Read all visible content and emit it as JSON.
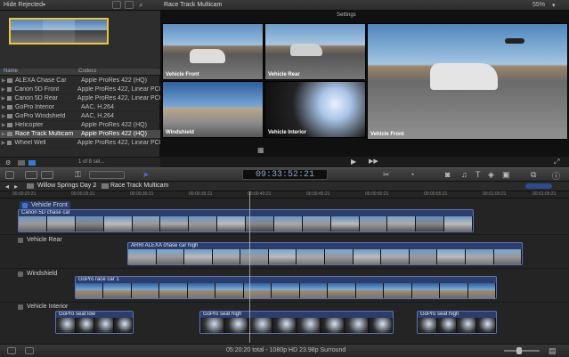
{
  "browser": {
    "filter_label": "Hide Rejected",
    "columns": {
      "name": "Name",
      "codecs": "Codecs"
    },
    "items": [
      {
        "name": "ALEXA Chase Car",
        "codec": "Apple ProRes 422 (HQ)"
      },
      {
        "name": "Canon 5D Front",
        "codec": "Apple ProRes 422, Linear PCM"
      },
      {
        "name": "Canon 5D Rear",
        "codec": "Apple ProRes 422, Linear PCM"
      },
      {
        "name": "GoPro Interior",
        "codec": "AAC, H.264"
      },
      {
        "name": "GoPro Windshield",
        "codec": "AAC, H.264"
      },
      {
        "name": "Helicopter",
        "codec": "Apple ProRes 422 (HQ)"
      },
      {
        "name": "Race Track Multicam",
        "codec": "Apple ProRes 422 (HQ)"
      },
      {
        "name": "Wheel Well",
        "codec": "Apple ProRes 422, Linear PCM"
      }
    ],
    "selection_status": "1 of 8 sel..."
  },
  "viewer": {
    "title": "Race Track Multicam",
    "zoom": "55%",
    "settings_label": "Settings",
    "angles": [
      {
        "label": "Vehicle Front"
      },
      {
        "label": "Vehicle Rear"
      },
      {
        "label": "Windshield"
      },
      {
        "label": "Vehicle Interior"
      }
    ],
    "main_label": "Vehicle Front"
  },
  "toolbar": {
    "timecode": "09:33:52:21"
  },
  "timeline": {
    "breadcrumb_project": "Willow Springs Day 2",
    "breadcrumb_clip": "Race Track Multicam",
    "ruler": [
      "00:00:20:21",
      "00:00:25:21",
      "00:00:30:21",
      "00:00:35:21",
      "00:00:40:21",
      "00:00:45:21",
      "00:00:50:21",
      "00:00:55:21",
      "00:01:00:21",
      "00:01:05:21"
    ],
    "lanes": [
      {
        "name": "Vehicle Front",
        "clips": [
          {
            "name": "Canon 5D chase car"
          }
        ]
      },
      {
        "name": "Vehicle Rear",
        "clips": [
          {
            "name": "ARRI ALEXA chase car high"
          }
        ]
      },
      {
        "name": "Windshield",
        "clips": [
          {
            "name": "GoPro race car 1"
          }
        ]
      },
      {
        "name": "Vehicle Interior",
        "clips": [
          {
            "name": "GoPro seat low"
          },
          {
            "name": "GoPro seat high"
          },
          {
            "name": "GoPro seat high"
          }
        ]
      }
    ]
  },
  "status": {
    "summary": "05:20:20 total - 1080p HD 23.98p Surround"
  },
  "colors": {
    "selection": "#e8c73c",
    "clip": "#2b3d6b",
    "active_tool": "#3b78d8"
  }
}
